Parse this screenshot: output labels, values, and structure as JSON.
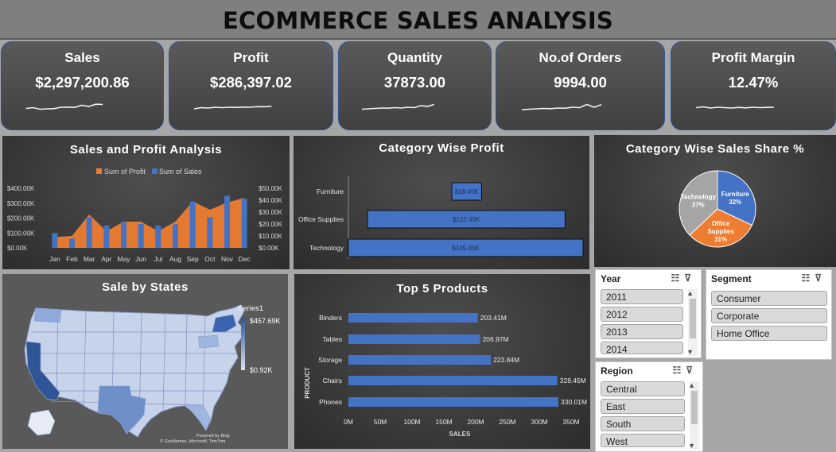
{
  "title": "ECOMMERCE SALES ANALYSIS",
  "kpis": [
    {
      "label": "Sales",
      "value": "$2,297,200.86",
      "spark": [
        0.45,
        0.55,
        0.35,
        0.4,
        0.42,
        0.6,
        0.62,
        0.58,
        0.85,
        0.7,
        0.98,
        0.95
      ]
    },
    {
      "label": "Profit",
      "value": "$286,397.02",
      "spark": [
        0.4,
        0.55,
        0.5,
        0.6,
        0.55,
        0.6,
        0.58,
        0.62,
        0.6,
        0.68,
        0.66,
        0.72
      ]
    },
    {
      "label": "Quantity",
      "value": "37873.00",
      "spark": [
        0.35,
        0.4,
        0.45,
        0.5,
        0.48,
        0.55,
        0.5,
        0.6,
        0.55,
        0.8,
        0.7,
        0.95
      ]
    },
    {
      "label": "No.of Orders",
      "value": "9994.00",
      "spark": [
        0.3,
        0.35,
        0.4,
        0.45,
        0.42,
        0.5,
        0.48,
        0.6,
        0.55,
        0.95,
        0.6,
        0.92
      ]
    },
    {
      "label": "Profit Margin",
      "value": "12.47%",
      "spark": [
        0.55,
        0.65,
        0.5,
        0.6,
        0.55,
        0.5,
        0.58,
        0.52,
        0.6,
        0.55,
        0.58,
        0.6
      ]
    }
  ],
  "sales_profit": {
    "title": "Sales and Profit Analysis",
    "legend_profit": "Sum of Profit",
    "legend_sales": "Sum of Sales",
    "left_ticks": [
      "$400.00K",
      "$300.00K",
      "$200.00K",
      "$100.00K",
      "$0.00K"
    ],
    "right_ticks": [
      "$50.00K",
      "$40.00K",
      "$30.00K",
      "$20.00K",
      "$10.00K",
      "$0.00K"
    ],
    "colors": {
      "profit": "#ed7d31",
      "sales": "#4472c4"
    }
  },
  "category_profit": {
    "title": "Category Wise Profit",
    "color": "#4472c4"
  },
  "sales_share": {
    "title": "Category Wise Sales Share %",
    "slices": [
      {
        "name": "Furniture",
        "pct_label": "32%",
        "value": 32,
        "color": "#4472c4"
      },
      {
        "name": "Office Supplies",
        "line1": "Office",
        "line2": "Supplies",
        "pct_label": "31%",
        "value": 31,
        "color": "#ed7d31"
      },
      {
        "name": "Technology",
        "pct_label": "37%",
        "value": 37,
        "color": "#a5a5a5"
      }
    ]
  },
  "states_map": {
    "title": "Sale by States",
    "legend_title": "Series1",
    "legend_max": "$457.69K",
    "legend_min": "$0.92K",
    "credit1": "Powered by Bing",
    "credit2": "© GeoNames, Microsoft, TomTom"
  },
  "top_products": {
    "title": "Top 5 Products",
    "ylabel": "PRODUCT",
    "xlabel": "SALES",
    "x_ticks": [
      "0M",
      "50M",
      "100M",
      "150M",
      "200M",
      "250M",
      "300M",
      "350M"
    ],
    "color": "#4472c4"
  },
  "slicers": {
    "year": {
      "title": "Year",
      "items": [
        "2011",
        "2012",
        "2013",
        "2014"
      ]
    },
    "segment": {
      "title": "Segment",
      "items": [
        "Consumer",
        "Corporate",
        "Home Office"
      ]
    },
    "region": {
      "title": "Region",
      "items": [
        "Central",
        "East",
        "South",
        "West"
      ]
    }
  },
  "chart_data": [
    {
      "type": "bar",
      "title": "Sales and Profit Analysis",
      "categories": [
        "Jan",
        "Feb",
        "Mar",
        "Apr",
        "May",
        "Jun",
        "Jul",
        "Aug",
        "Sep",
        "Oct",
        "Nov",
        "Dec"
      ],
      "series": [
        {
          "name": "Sum of Profit",
          "chart": "area",
          "axis": "right",
          "values": [
            9,
            10,
            28,
            14,
            22,
            22,
            14,
            22,
            39,
            32,
            38,
            42
          ]
        },
        {
          "name": "Sum of Sales",
          "chart": "bar",
          "axis": "left",
          "values": [
            98,
            62,
            206,
            150,
            173,
            160,
            150,
            158,
            310,
            205,
            350,
            330
          ]
        }
      ],
      "ylim_left": [
        0,
        400
      ],
      "ylim_right": [
        0,
        50
      ]
    },
    {
      "type": "bar",
      "title": "Category Wise Profit",
      "orientation": "horizontal",
      "categories": [
        "Furniture",
        "Office Supplies",
        "Technology"
      ],
      "values": [
        18.45,
        122.49,
        145.45
      ],
      "labels": [
        "$18.45K",
        "$122.49K",
        "$145.45K"
      ]
    },
    {
      "type": "pie",
      "title": "Category Wise Sales Share %",
      "categories": [
        "Furniture",
        "Office Supplies",
        "Technology"
      ],
      "values": [
        32,
        31,
        37
      ]
    },
    {
      "type": "bar",
      "title": "Top 5 Products",
      "orientation": "horizontal",
      "categories": [
        "Binders",
        "Tables",
        "Storage",
        "Chairs",
        "Phones"
      ],
      "values": [
        203.41,
        206.97,
        223.84,
        328.45,
        330.01
      ],
      "labels": [
        "203.41M",
        "206.97M",
        "223.84M",
        "328.45M",
        "330.01M"
      ],
      "xlabel": "SALES",
      "ylabel": "PRODUCT",
      "xlim": [
        0,
        350
      ]
    }
  ]
}
